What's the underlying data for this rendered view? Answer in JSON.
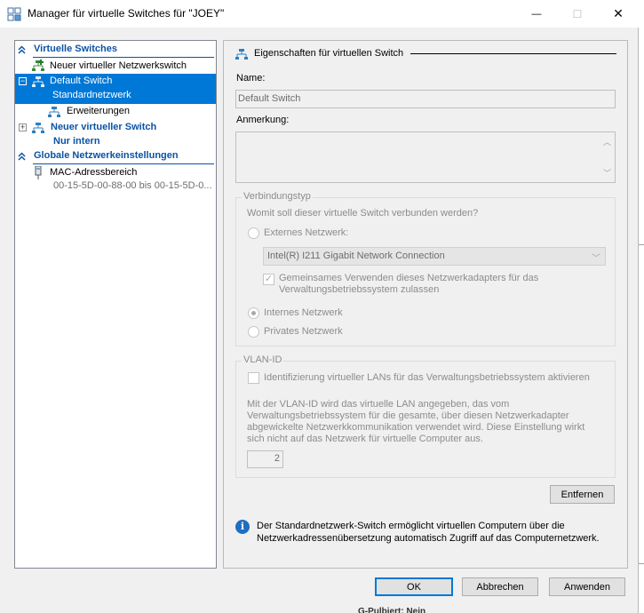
{
  "window": {
    "title": "Manager für virtuelle Switches für \"JOEY\"",
    "icon": "hyperv-switch-manager-icon",
    "controls": {
      "minimize": "—",
      "maximize": "☐",
      "close": "✕"
    }
  },
  "tree": {
    "virtual_switches_header": "Virtuelle Switches",
    "new_switch": "Neuer virtueller Netzwerkswitch",
    "default_switch": {
      "name": "Default Switch",
      "type": "Standardnetzwerk",
      "expander": "−"
    },
    "extensions": "Erweiterungen",
    "new_switch_node": {
      "name": "Neuer virtueller Switch",
      "type": "Nur intern",
      "expander": "+"
    },
    "global_header": "Globale Netzwerkeinstellungen",
    "mac_range": {
      "name": "MAC-Adressbereich",
      "value": "00-15-5D-00-88-00 bis 00-15-5D-0..."
    }
  },
  "properties": {
    "header": "Eigenschaften für virtuellen Switch",
    "name_label": "Name:",
    "name_value": "Default Switch",
    "notes_label": "Anmerkung:",
    "connection_group": "Verbindungstyp",
    "connection_question": "Womit soll dieser virtuelle Switch verbunden werden?",
    "external": "Externes Netzwerk:",
    "adapter": "Intel(R) I211 Gigabit Network Connection",
    "share_adapter": "Gemeinsames Verwenden dieses Netzwerkadapters für das Verwaltungsbetriebssystem zulassen",
    "internal": "Internes Netzwerk",
    "private": "Privates Netzwerk",
    "vlan_group": "VLAN-ID",
    "vlan_enable": "Identifizierung virtueller LANs für das Verwaltungsbetriebssystem aktivieren",
    "vlan_desc": "Mit der VLAN-ID wird das virtuelle LAN angegeben, das vom Verwaltungsbetriebssystem für die gesamte, über diesen Netzwerkadapter abgewickelte Netzwerkkommunikation verwendet wird. Diese Einstellung wirkt sich nicht auf das Netzwerk für virtuelle Computer aus.",
    "vlan_value": "2",
    "remove_button": "Entfernen",
    "info_text": "Der Standardnetzwerk-Switch ermöglicht virtuellen Computern über die Netzwerkadressenübersetzung automatisch Zugriff auf das Computernetzwerk.",
    "info_icon_glyph": "i"
  },
  "footer": {
    "ok": "OK",
    "cancel": "Abbrechen",
    "apply": "Anwenden"
  },
  "background_partial_text": "G-Pulbiert:  Nein",
  "colors": {
    "accent": "#0078d7",
    "section_blue": "#0b53a5",
    "disabled_text": "#8c8c8c"
  }
}
